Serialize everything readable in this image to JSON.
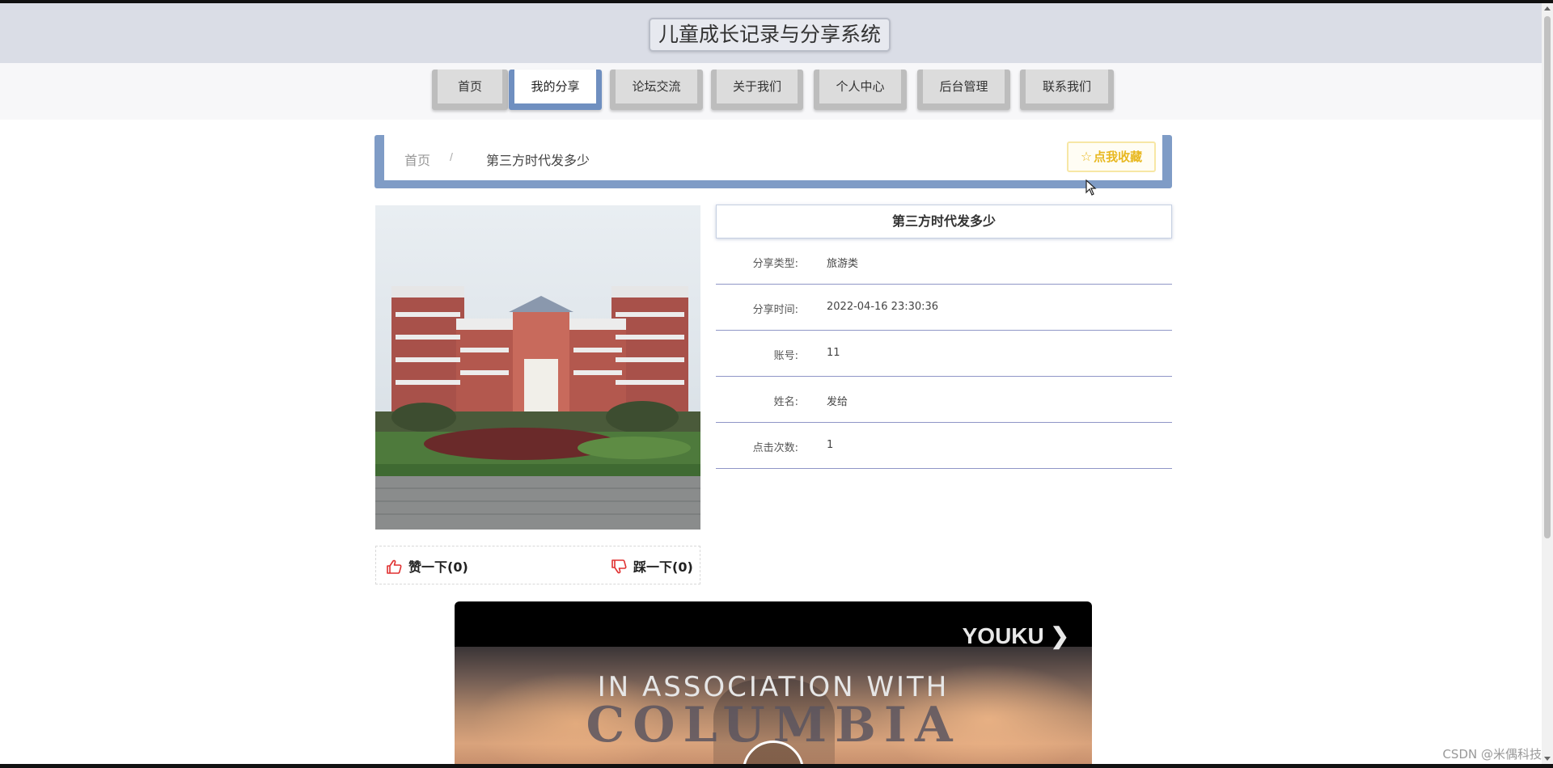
{
  "header": {
    "site_title": "儿童成长记录与分享系统"
  },
  "nav": {
    "tabs": [
      {
        "label": "首页",
        "active": false
      },
      {
        "label": "我的分享",
        "active": true
      },
      {
        "label": "论坛交流",
        "active": false
      },
      {
        "label": "关于我们",
        "active": false
      },
      {
        "label": "个人中心",
        "active": false
      },
      {
        "label": "后台管理",
        "active": false
      },
      {
        "label": "联系我们",
        "active": false
      }
    ]
  },
  "breadcrumb": {
    "home": "首页",
    "separator": "/",
    "current": "第三方时代发多少",
    "favorite_label": "点我收藏",
    "favorite_icon": "star-outline-icon"
  },
  "detail": {
    "title": "第三方时代发多少",
    "rows": [
      {
        "label": "分享类型:",
        "value": "旅游类"
      },
      {
        "label": "分享时间:",
        "value": "2022-04-16 23:30:36"
      },
      {
        "label": "账号:",
        "value": "11"
      },
      {
        "label": "姓名:",
        "value": "发给"
      },
      {
        "label": "点击次数:",
        "value": "1"
      }
    ]
  },
  "votes": {
    "like_label": "赞一下(0)",
    "like_icon": "thumbs-up-icon",
    "dislike_label": "踩一下(0)",
    "dislike_icon": "thumbs-down-icon"
  },
  "video": {
    "brand": "YOUKU",
    "caption": "IN ASSOCIATION WITH",
    "overlay_text": "COLUMBIA"
  },
  "watermark": "CSDN @米偶科技",
  "colors": {
    "header_bg": "#dadde6",
    "active_tab_accent": "#6f8fc0",
    "breadcrumb_frame": "#7f9cc6",
    "favorite_gold": "#e8b820",
    "vote_red": "#e03030"
  }
}
